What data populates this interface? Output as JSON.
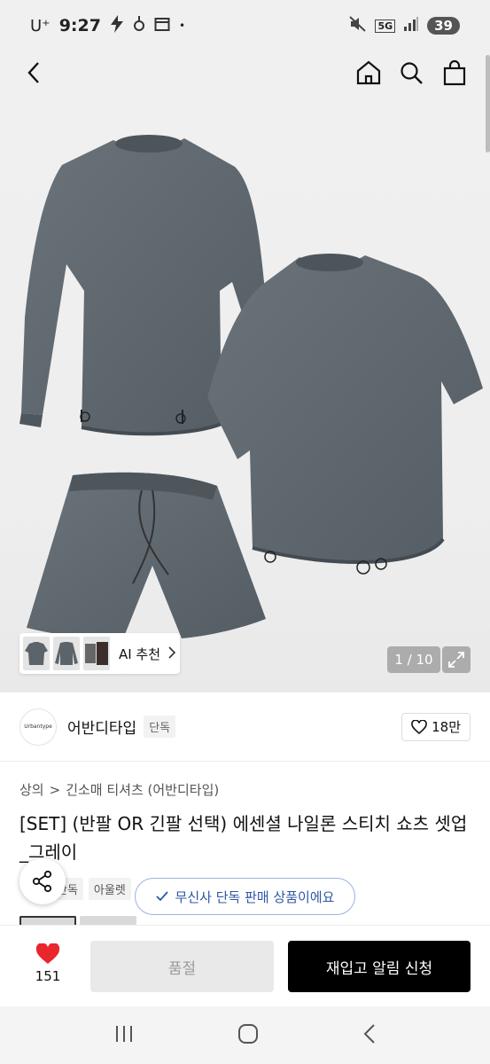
{
  "status": {
    "carrier": "U⁺",
    "time": "9:27",
    "network": "5G",
    "battery": "39",
    "dot": "•"
  },
  "hero": {
    "page_counter": "1 / 10",
    "ai_recommend_label": "AI 추천"
  },
  "brand": {
    "logo_text": "Urbantype",
    "name": "어반디타입",
    "tag": "단독",
    "like_count": "18만"
  },
  "breadcrumb": {
    "level1": "상의",
    "separator": ">",
    "level2": "긴소매 티셔츠 (어반디타입)"
  },
  "product": {
    "title": "[SET] (반팔 OR 긴팔 선택) 에센셜 나일론 스티치 쇼츠 셋업_그레이",
    "tags": [
      "단독",
      "아울렛"
    ],
    "exclusive_notice": "무신사 단독 판매 상품이에요"
  },
  "bottom_bar": {
    "heart_count": "151",
    "soldout_label": "품절",
    "restock_label": "재입고 알림 신청"
  },
  "colors": {
    "garment": "#5c646b",
    "accent_red": "#e8262b",
    "notice_blue": "#2f57a4"
  }
}
